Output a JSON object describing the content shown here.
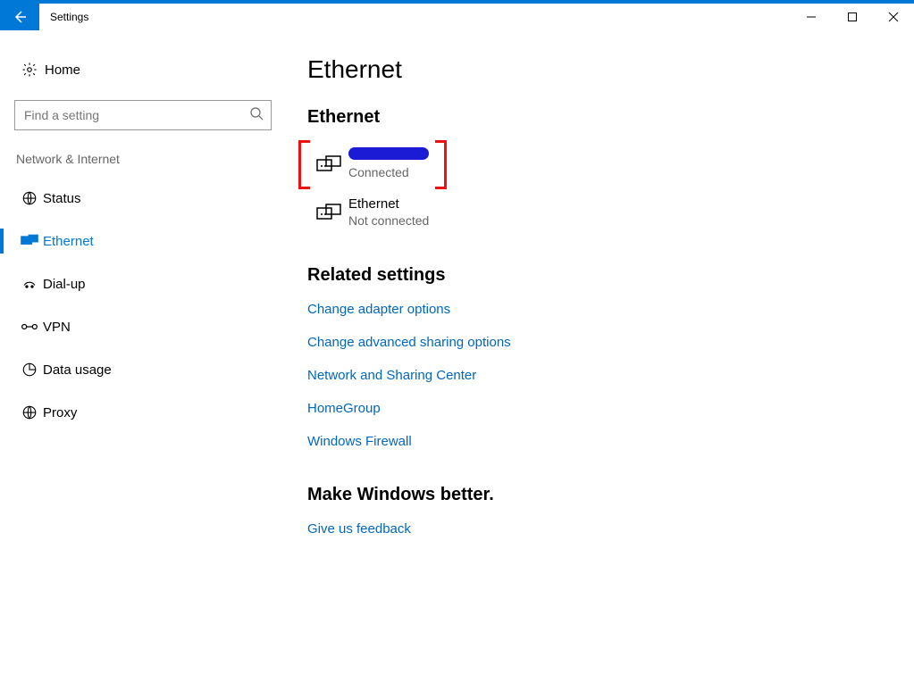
{
  "window": {
    "title": "Settings"
  },
  "sidebar": {
    "home": "Home",
    "search_placeholder": "Find a setting",
    "category": "Network & Internet",
    "items": [
      {
        "label": "Status"
      },
      {
        "label": "Ethernet"
      },
      {
        "label": "Dial-up"
      },
      {
        "label": "VPN"
      },
      {
        "label": "Data usage"
      },
      {
        "label": "Proxy"
      }
    ]
  },
  "content": {
    "page_title": "Ethernet",
    "section_connections": "Ethernet",
    "connections": [
      {
        "name": "",
        "status": "Connected",
        "redacted": true
      },
      {
        "name": "Ethernet",
        "status": "Not connected",
        "redacted": false
      }
    ],
    "section_related": "Related settings",
    "related_links": [
      "Change adapter options",
      "Change advanced sharing options",
      "Network and Sharing Center",
      "HomeGroup",
      "Windows Firewall"
    ],
    "section_feedback": "Make Windows better.",
    "feedback_link": "Give us feedback"
  }
}
